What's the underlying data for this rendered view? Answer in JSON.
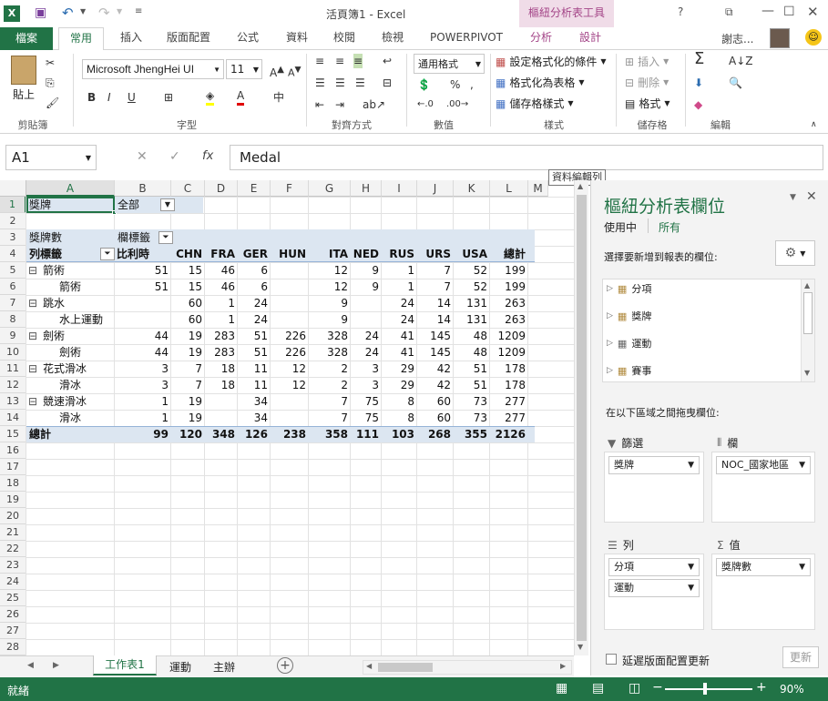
{
  "window": {
    "title": "活頁簿1 - Excel",
    "context_tab_group": "樞紐分析表工具",
    "user": "謝志..."
  },
  "tabs": [
    {
      "label": "檔案"
    },
    {
      "label": "常用"
    },
    {
      "label": "插入"
    },
    {
      "label": "版面配置"
    },
    {
      "label": "公式"
    },
    {
      "label": "資料"
    },
    {
      "label": "校閱"
    },
    {
      "label": "檢視"
    },
    {
      "label": "POWERPIVOT"
    },
    {
      "label": "分析"
    },
    {
      "label": "設計"
    }
  ],
  "ribbon": {
    "paste": "貼上",
    "font_name": "Microsoft JhengHei UI",
    "font_size": "11",
    "number_format": "通用格式",
    "conditional_format": "設定格式化的條件",
    "format_as_table": "格式化為表格",
    "cell_styles": "儲存格樣式",
    "insert": "插入",
    "delete": "刪除",
    "format": "格式",
    "groups": {
      "clipboard": "剪貼簿",
      "font": "字型",
      "alignment": "對齊方式",
      "number": "數值",
      "styles": "樣式",
      "cells": "儲存格",
      "editing": "編輯"
    }
  },
  "formula_bar": {
    "name_box": "A1",
    "value": "Medal",
    "tooltip": "資料編輯列"
  },
  "columns": [
    "A",
    "B",
    "C",
    "D",
    "E",
    "F",
    "G",
    "H",
    "I",
    "J",
    "K",
    "L",
    "M"
  ],
  "rows": [
    "1",
    "2",
    "3",
    "4",
    "5",
    "6",
    "7",
    "8",
    "9",
    "10",
    "11",
    "12",
    "13",
    "14",
    "15",
    "16",
    "17",
    "18",
    "19",
    "20",
    "21",
    "22",
    "23",
    "24",
    "25",
    "26",
    "27",
    "28"
  ],
  "pivot": {
    "filter_label": "獎牌",
    "filter_value": "全部",
    "values_label": "獎牌數",
    "col_labels": "欄標籤",
    "row_labels": "列標籤",
    "col_headers": [
      "比利時",
      "CHN",
      "FRA",
      "GER",
      "HUN",
      "ITA",
      "NED",
      "RUS",
      "URS",
      "USA",
      "總計"
    ],
    "data": [
      {
        "label": "箭術",
        "indent": 0,
        "expand": "⊟",
        "vals": [
          "51",
          "15",
          "46",
          "6",
          "",
          "12",
          "9",
          "1",
          "7",
          "52",
          "199"
        ]
      },
      {
        "label": "箭術",
        "indent": 1,
        "expand": "",
        "vals": [
          "51",
          "15",
          "46",
          "6",
          "",
          "12",
          "9",
          "1",
          "7",
          "52",
          "199"
        ]
      },
      {
        "label": "跳水",
        "indent": 0,
        "expand": "⊟",
        "vals": [
          "",
          "60",
          "1",
          "24",
          "",
          "9",
          "",
          "24",
          "14",
          "131",
          "263"
        ]
      },
      {
        "label": "水上運動",
        "indent": 1,
        "expand": "",
        "vals": [
          "",
          "60",
          "1",
          "24",
          "",
          "9",
          "",
          "24",
          "14",
          "131",
          "263"
        ]
      },
      {
        "label": "劍術",
        "indent": 0,
        "expand": "⊟",
        "vals": [
          "44",
          "19",
          "283",
          "51",
          "226",
          "328",
          "24",
          "41",
          "145",
          "48",
          "1209"
        ]
      },
      {
        "label": "劍術",
        "indent": 1,
        "expand": "",
        "vals": [
          "44",
          "19",
          "283",
          "51",
          "226",
          "328",
          "24",
          "41",
          "145",
          "48",
          "1209"
        ]
      },
      {
        "label": "花式滑冰",
        "indent": 0,
        "expand": "⊟",
        "vals": [
          "3",
          "7",
          "18",
          "11",
          "12",
          "2",
          "3",
          "29",
          "42",
          "51",
          "178"
        ]
      },
      {
        "label": "滑冰",
        "indent": 1,
        "expand": "",
        "vals": [
          "3",
          "7",
          "18",
          "11",
          "12",
          "2",
          "3",
          "29",
          "42",
          "51",
          "178"
        ]
      },
      {
        "label": "競速滑冰",
        "indent": 0,
        "expand": "⊟",
        "vals": [
          "1",
          "19",
          "",
          "34",
          "",
          "7",
          "75",
          "8",
          "60",
          "73",
          "277"
        ]
      },
      {
        "label": "滑冰",
        "indent": 1,
        "expand": "",
        "vals": [
          "1",
          "19",
          "",
          "34",
          "",
          "7",
          "75",
          "8",
          "60",
          "73",
          "277"
        ]
      }
    ],
    "total_label": "總計",
    "totals": [
      "99",
      "120",
      "348",
      "126",
      "238",
      "358",
      "111",
      "103",
      "268",
      "355",
      "2126"
    ]
  },
  "pane": {
    "title": "樞紐分析表欄位",
    "tab_active": "使用中",
    "tab_all": "所有",
    "choose_label": "選擇要新增到報表的欄位:",
    "fields": [
      {
        "name": "分項"
      },
      {
        "name": "獎牌"
      },
      {
        "name": "運動"
      },
      {
        "name": "賽事"
      }
    ],
    "drag_label": "在以下區域之間拖曳欄位:",
    "filters_title": "篩選",
    "columns_title": "欄",
    "rows_title": "列",
    "values_title": "值",
    "filters": [
      "獎牌"
    ],
    "columns_area": [
      "NOC_國家地區"
    ],
    "rows_area": [
      "分項",
      "運動"
    ],
    "values_area": [
      "獎牌數"
    ],
    "defer_label": "延遲版面配置更新",
    "update_button": "更新"
  },
  "sheets": [
    {
      "name": "工作表1"
    },
    {
      "name": "運動"
    },
    {
      "name": "主辦"
    }
  ],
  "status": {
    "ready": "就緒",
    "zoom": "90%"
  },
  "colors": {
    "brand": "#217346",
    "pivot_header": "#dce6f1"
  }
}
